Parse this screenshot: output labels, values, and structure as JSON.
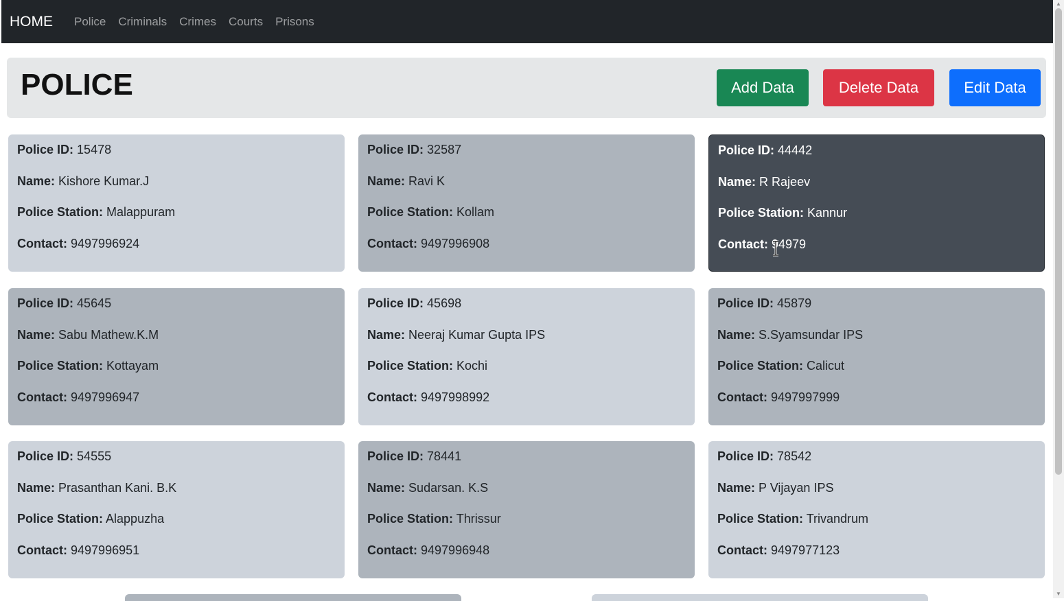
{
  "navbar": {
    "brand": "HOME",
    "links": [
      "Police",
      "Criminals",
      "Crimes",
      "Courts",
      "Prisons"
    ]
  },
  "header": {
    "title": "POLICE",
    "buttons": {
      "add": "Add Data",
      "delete": "Delete Data",
      "edit": "Edit Data"
    }
  },
  "labels": {
    "id": "Police ID:",
    "name": "Name:",
    "station": "Police Station:",
    "contact": "Contact:"
  },
  "colors": {
    "add": "#198754",
    "delete": "#dc3545",
    "edit": "#0d6efd",
    "navbar": "#212529"
  },
  "cards": [
    {
      "id": "15478",
      "name": "Kishore Kumar.J",
      "station": "Malappuram",
      "contact": "9497996924"
    },
    {
      "id": "32587",
      "name": "Ravi K",
      "station": "Kollam",
      "contact": "9497996908"
    },
    {
      "id": "44442",
      "name": "R Rajeev",
      "station": "Kannur",
      "contact": "94979"
    },
    {
      "id": "45645",
      "name": "Sabu Mathew.K.M",
      "station": "Kottayam",
      "contact": "9497996947"
    },
    {
      "id": "45698",
      "name": "Neeraj Kumar Gupta IPS",
      "station": "Kochi",
      "contact": "9497998992"
    },
    {
      "id": "45879",
      "name": "S.Syamsundar IPS",
      "station": "Calicut",
      "contact": "9497997999"
    },
    {
      "id": "54555",
      "name": "Prasanthan Kani. B.K",
      "station": "Alappuzha",
      "contact": "9497996951"
    },
    {
      "id": "78441",
      "name": "Sudarsan. K.S",
      "station": "Thrissur",
      "contact": "9497996948"
    },
    {
      "id": "78542",
      "name": "P Vijayan IPS",
      "station": "Trivandrum",
      "contact": "9497977123"
    }
  ]
}
